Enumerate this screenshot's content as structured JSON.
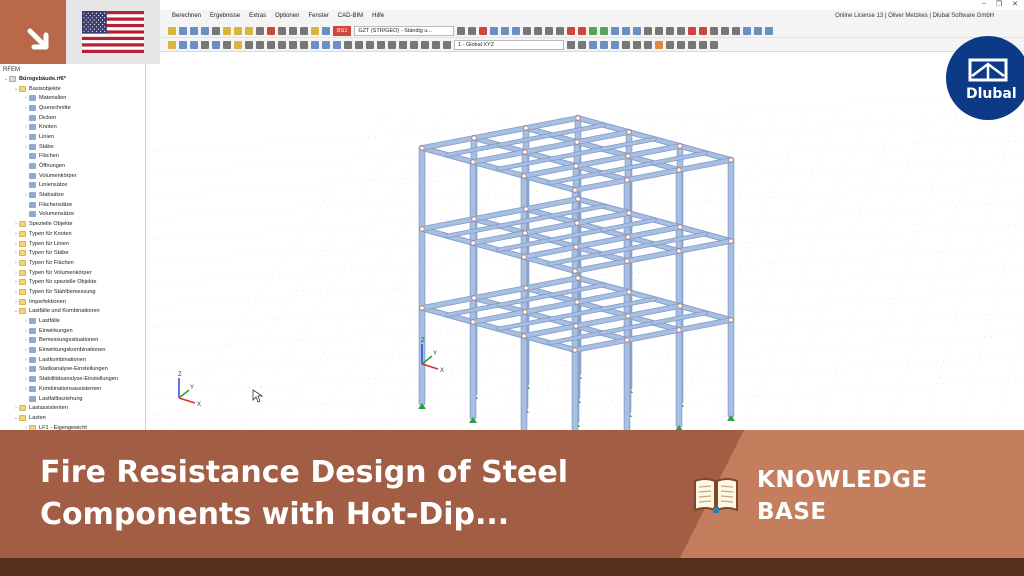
{
  "menu": {
    "items": [
      "Berechnen",
      "Ergebnisse",
      "Extras",
      "Optionen",
      "Fenster",
      "CAD-BIM",
      "Hilfe"
    ],
    "license": "Online License 13 | Oliver Metzkes | Dlubal Software GmbH"
  },
  "toolbar": {
    "load_case_badge": "BS1",
    "combination_value": "GZT (STR/GEO) - Ständig u...",
    "coordinate_system_value": "1 - Global XYZ"
  },
  "navigator": {
    "header": "RFEM",
    "items": [
      {
        "label": "Bürogebäude.rf6*",
        "depth": 0,
        "expanded": true,
        "icon": "file"
      },
      {
        "label": "Basisobjekte",
        "depth": 1,
        "expanded": true,
        "icon": "folder"
      },
      {
        "label": "Materialien",
        "depth": 2,
        "expanded": false,
        "icon": "item"
      },
      {
        "label": "Querschnitte",
        "depth": 2,
        "expanded": false,
        "icon": "item"
      },
      {
        "label": "Dicken",
        "depth": 2,
        "expanded": null,
        "icon": "item"
      },
      {
        "label": "Knoten",
        "depth": 2,
        "expanded": false,
        "icon": "item"
      },
      {
        "label": "Linien",
        "depth": 2,
        "expanded": false,
        "icon": "item"
      },
      {
        "label": "Stäbe",
        "depth": 2,
        "expanded": false,
        "icon": "item"
      },
      {
        "label": "Flächen",
        "depth": 2,
        "expanded": null,
        "icon": "item"
      },
      {
        "label": "Öffnungen",
        "depth": 2,
        "expanded": null,
        "icon": "item"
      },
      {
        "label": "Volumenkörper",
        "depth": 2,
        "expanded": null,
        "icon": "item"
      },
      {
        "label": "Liniensätze",
        "depth": 2,
        "expanded": null,
        "icon": "item"
      },
      {
        "label": "Stabsätze",
        "depth": 2,
        "expanded": false,
        "icon": "item"
      },
      {
        "label": "Flächensätze",
        "depth": 2,
        "expanded": null,
        "icon": "item"
      },
      {
        "label": "Volumensätze",
        "depth": 2,
        "expanded": null,
        "icon": "item"
      },
      {
        "label": "Spezielle Objekte",
        "depth": 1,
        "expanded": false,
        "icon": "folder"
      },
      {
        "label": "Typen für Knoten",
        "depth": 1,
        "expanded": false,
        "icon": "folder"
      },
      {
        "label": "Typen für Linien",
        "depth": 1,
        "expanded": false,
        "icon": "folder"
      },
      {
        "label": "Typen für Stäbe",
        "depth": 1,
        "expanded": false,
        "icon": "folder"
      },
      {
        "label": "Typen für Flächen",
        "depth": 1,
        "expanded": false,
        "icon": "folder"
      },
      {
        "label": "Typen für Volumenkörper",
        "depth": 1,
        "expanded": false,
        "icon": "folder"
      },
      {
        "label": "Typen für spezielle Objekte",
        "depth": 1,
        "expanded": false,
        "icon": "folder"
      },
      {
        "label": "Typen für Stahlbemessung",
        "depth": 1,
        "expanded": false,
        "icon": "folder"
      },
      {
        "label": "Imperfektionen",
        "depth": 1,
        "expanded": false,
        "icon": "folder"
      },
      {
        "label": "Lastfälle und Kombinationen",
        "depth": 1,
        "expanded": true,
        "icon": "folder"
      },
      {
        "label": "Lastfälle",
        "depth": 2,
        "expanded": false,
        "icon": "item"
      },
      {
        "label": "Einwirkungen",
        "depth": 2,
        "expanded": false,
        "icon": "item"
      },
      {
        "label": "Bemessungssituationen",
        "depth": 2,
        "expanded": false,
        "icon": "item"
      },
      {
        "label": "Einwirkungskombinationen",
        "depth": 2,
        "expanded": false,
        "icon": "item"
      },
      {
        "label": "Lastkombinationen",
        "depth": 2,
        "expanded": false,
        "icon": "item"
      },
      {
        "label": "Statikanalyse-Einstellungen",
        "depth": 2,
        "expanded": false,
        "icon": "item"
      },
      {
        "label": "Stabilitätsanalyse-Einstellungen",
        "depth": 2,
        "expanded": false,
        "icon": "item"
      },
      {
        "label": "Kombinationsassistenten",
        "depth": 2,
        "expanded": false,
        "icon": "item"
      },
      {
        "label": "Lastfallbeziehung",
        "depth": 2,
        "expanded": null,
        "icon": "item"
      },
      {
        "label": "Lastassistenten",
        "depth": 1,
        "expanded": false,
        "icon": "folder"
      },
      {
        "label": "Lasten",
        "depth": 1,
        "expanded": true,
        "icon": "folder"
      },
      {
        "label": "LF1 - Eigengewicht",
        "depth": 2,
        "expanded": false,
        "icon": "folder"
      }
    ]
  },
  "viewport": {
    "axis_labels": {
      "x": "X",
      "y": "Y",
      "z": "Z"
    },
    "colors": {
      "member": "#a8bfe2",
      "member_edge": "#7e9bc8",
      "support": "#2f9e44",
      "grid": "#d6d6d6"
    }
  },
  "badge": {
    "brand": "Dlubal"
  },
  "flag": {
    "country": "United States",
    "icon": "us-flag-icon"
  },
  "banner": {
    "title": "Fire Resistance Design of Steel Components with Hot-Dip...",
    "category": "KNOWLEDGE BASE",
    "colors": {
      "primary": "#a25d45",
      "accent": "#c47d5d",
      "footer": "#55301f"
    }
  }
}
